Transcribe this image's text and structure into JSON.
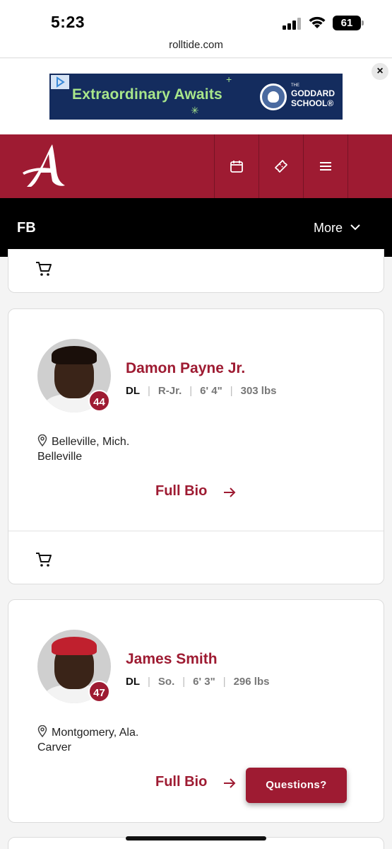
{
  "status_bar": {
    "time": "5:23",
    "battery": "61"
  },
  "url_bar": {
    "url": "rolltide.com"
  },
  "ad": {
    "headline": "Extraordinary Awaits",
    "brand_small": "THE",
    "brand_line1": "GODDARD",
    "brand_line2": "SCHOOL®",
    "close": "×"
  },
  "site": {
    "accent": "#9e1b32"
  },
  "sub_nav": {
    "title": "FB",
    "more": "More"
  },
  "players": [
    {
      "name": "Damon Payne Jr.",
      "number": "44",
      "position": "DL",
      "class": "R-Jr.",
      "height": "6' 4\"",
      "weight": "303 lbs",
      "hometown": "Belleville, Mich.",
      "school": "Belleville",
      "bio_label": "Full Bio"
    },
    {
      "name": "James Smith",
      "number": "47",
      "position": "DL",
      "class": "So.",
      "height": "6' 3\"",
      "weight": "296 lbs",
      "hometown": "Montgomery, Ala.",
      "school": "Carver",
      "bio_label": "Full Bio"
    }
  ],
  "questions_button": {
    "label": "Questions?"
  }
}
